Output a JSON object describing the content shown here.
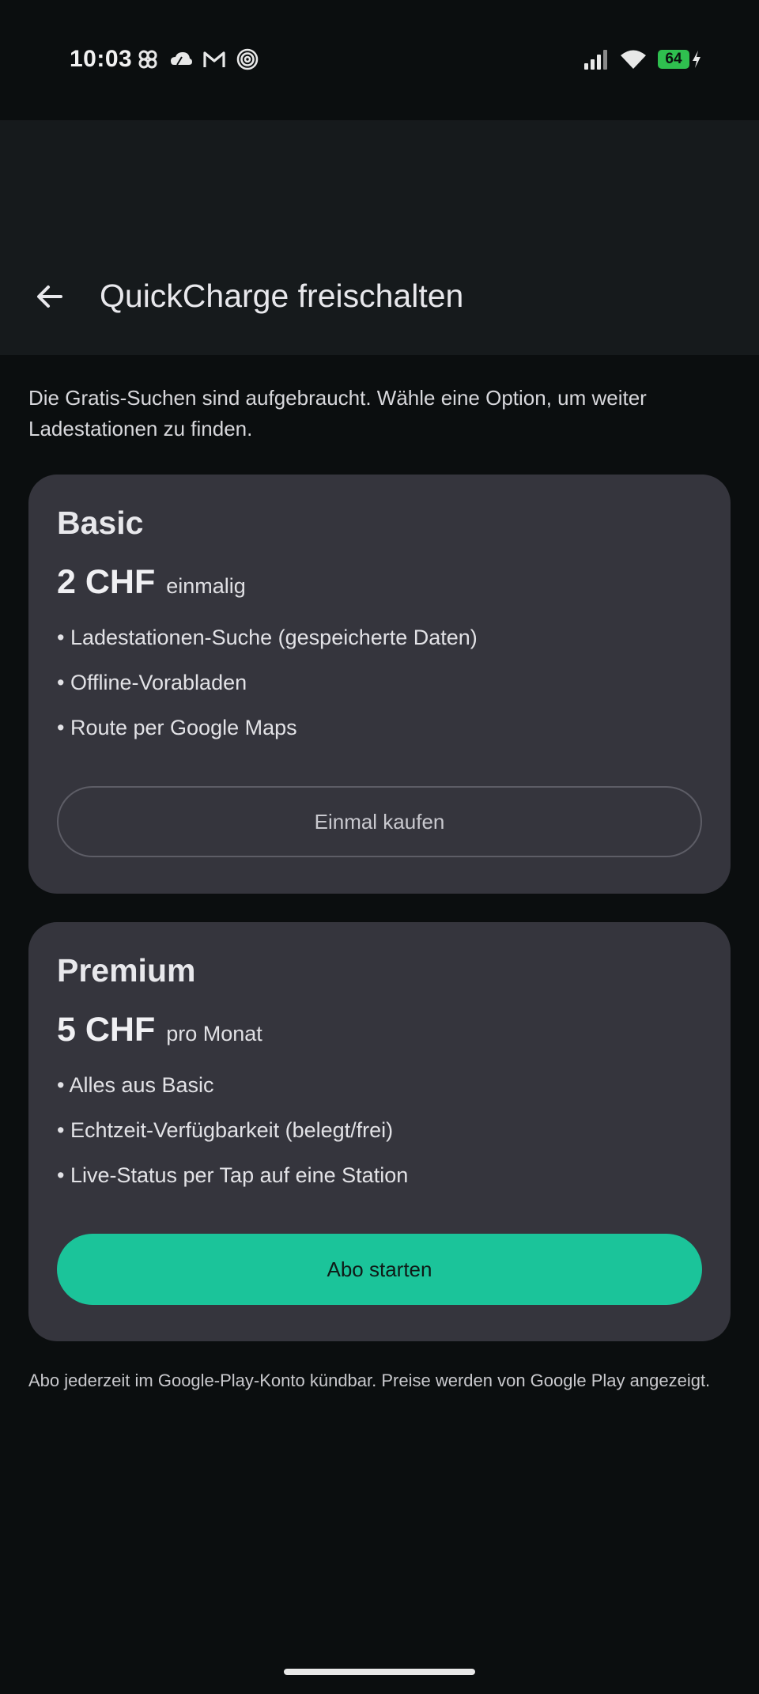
{
  "status_bar": {
    "time": "10:03",
    "battery": "64",
    "left_icons": [
      "pinwheel-icon",
      "cloud-icon",
      "gmail-icon",
      "target-icon"
    ],
    "right_icons": [
      "signal-icon",
      "wifi-icon",
      "battery-icon",
      "charging-icon"
    ]
  },
  "header": {
    "title": "QuickCharge freischalten",
    "back_icon": "arrow-left-icon"
  },
  "intro": "Die Gratis-Suchen sind aufgebraucht. Wähle eine Option, um weiter Ladestationen zu finden.",
  "plans": [
    {
      "name": "Basic",
      "price": "2 CHF",
      "period": "einmalig",
      "features": [
        "• Ladestationen-Suche (gespeicherte Daten)",
        "• Offline-Vorabladen",
        "• Route per Google Maps"
      ],
      "button": "Einmal kaufen"
    },
    {
      "name": "Premium",
      "price": "5 CHF",
      "period": "pro Monat",
      "features": [
        "• Alles aus Basic",
        "• Echtzeit-Verfügbarkeit (belegt/frei)",
        "• Live-Status per Tap auf eine Station"
      ],
      "button": "Abo starten"
    }
  ],
  "footnote": "Abo jederzeit im Google-Play-Konto kündbar. Preise werden von Google Play angezeigt.",
  "colors": {
    "background": "#0b0e0f",
    "appbar": "#161a1c",
    "card": "#35353d",
    "accent": "#1bc49a",
    "battery": "#2fbf4f"
  }
}
